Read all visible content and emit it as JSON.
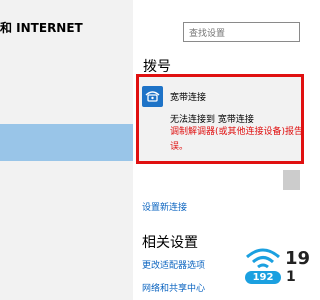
{
  "header": {
    "title": "和 INTERNET"
  },
  "search": {
    "placeholder": "查找设置"
  },
  "dialup": {
    "title": "拨号",
    "connection": {
      "name": "宽带连接",
      "status": "无法连接到 宽带连接",
      "error_line1": "调制解调器(或其他连接设备)报告了",
      "error_line2": "误。"
    },
    "setup_link": "设置新连接"
  },
  "related": {
    "title": "相关设置",
    "links": [
      "更改适配器选项",
      "网络和共享中心"
    ]
  },
  "watermark": {
    "badge": "192",
    "num1": "19",
    "num2": "1"
  },
  "colors": {
    "accent": "#1e73c7",
    "error": "#e01010",
    "highlight": "#e01010",
    "nav_selected": "#99c5e8",
    "link": "#0b64c0"
  },
  "icons": {
    "connection": "dialup-connection-icon"
  }
}
